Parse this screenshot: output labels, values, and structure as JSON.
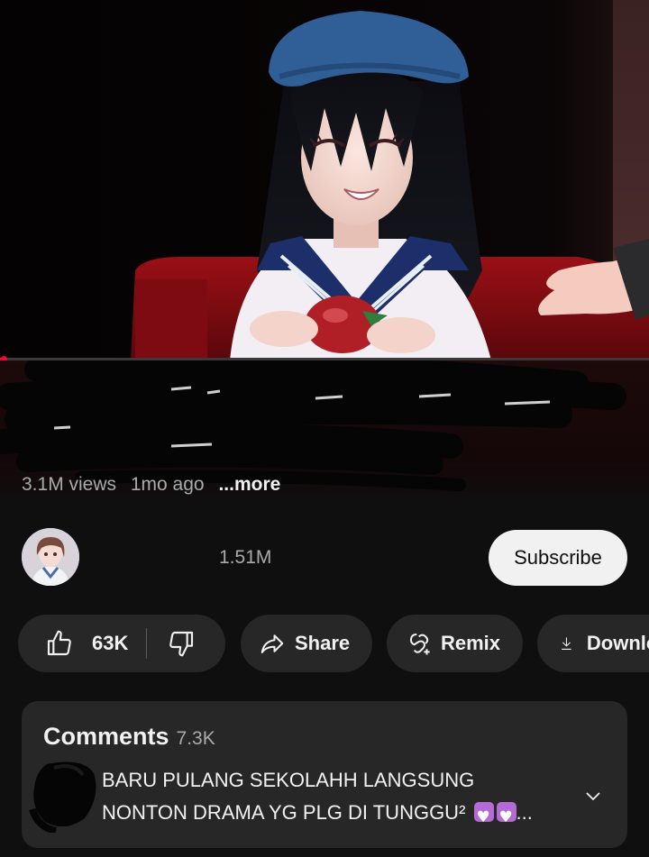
{
  "video": {
    "progress": 0.005,
    "meta": {
      "views": "3.1M views",
      "age": "1mo ago",
      "more": "...more"
    }
  },
  "channel": {
    "subscribers": "1.51M",
    "subscribe_label": "Subscribe"
  },
  "actions": {
    "likes": "63K",
    "share": "Share",
    "remix": "Remix",
    "download": "Download",
    "icons": [
      "thumb-up-icon",
      "thumb-down-icon",
      "share-icon",
      "remix-icon",
      "download-icon"
    ]
  },
  "comments": {
    "title": "Comments",
    "count": "7.3K",
    "top_comment_line1": "BARU PULANG SEKOLAHH LANGSUNG",
    "top_comment_line2": "NONTON DRAMA YG PLG DI TUNGGU²",
    "ellipsis": "..."
  },
  "colors": {
    "background": "#0f0f0f",
    "pill": "#272727",
    "progress": "#ff0033",
    "subscribe_bg": "#f1f1f1",
    "heart_emoji": "#b46bd6"
  }
}
